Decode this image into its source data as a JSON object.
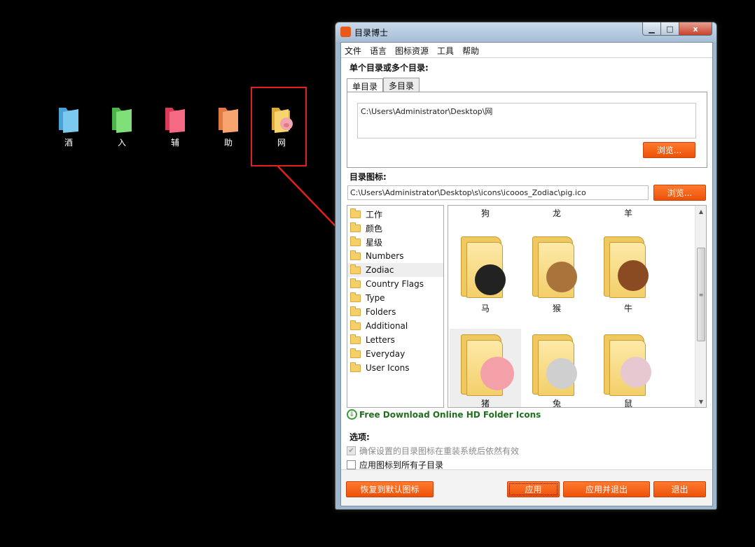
{
  "desktop": {
    "icons": [
      {
        "label": "酒",
        "color": "#5bb8e8"
      },
      {
        "label": "入",
        "color": "#6fd36a"
      },
      {
        "label": "辅",
        "color": "#f0506a"
      },
      {
        "label": "助",
        "color": "#f2955a"
      },
      {
        "label": "网",
        "color": "#f2c95a"
      }
    ]
  },
  "window": {
    "title": "目录博士",
    "controls": {
      "minimize": "▁",
      "maximize": "□",
      "close": "x"
    }
  },
  "menu": [
    "文件",
    "语言",
    "图标资源",
    "工具",
    "帮助"
  ],
  "directory_section": {
    "label": "单个目录或多个目录:",
    "tabs": [
      "单目录",
      "多目录"
    ],
    "active_tab": "单目录",
    "path": "C:\\Users\\Administrator\\Desktop\\网",
    "browse": "浏览..."
  },
  "icon_section": {
    "label": "目录图标:",
    "path": "C:\\Users\\Administrator\\Desktop\\s\\icons\\icooos_Zodiac\\pig.ico",
    "browse": "浏览..."
  },
  "categories": [
    "工作",
    "颜色",
    "星级",
    "Numbers",
    "Zodiac",
    "Country Flags",
    "Type",
    "Folders",
    "Additional",
    "Letters",
    "Everyday",
    "User Icons"
  ],
  "selected_category": "Zodiac",
  "icon_grid": {
    "top_row": [
      "狗",
      "龙",
      "羊"
    ],
    "rows": [
      [
        {
          "name": "马",
          "color": "#222222",
          "glyph": "马"
        },
        {
          "name": "猴",
          "color": "#a8743c",
          "glyph": "猴"
        },
        {
          "name": "牛",
          "color": "#8a4a22",
          "glyph": "牛"
        }
      ],
      [
        {
          "name": "猪",
          "color": "#f4a0a8",
          "glyph": "猪"
        },
        {
          "name": "兔",
          "color": "#cfcfcf",
          "glyph": "兔"
        },
        {
          "name": "鼠",
          "color": "#e8c8d0",
          "glyph": "鼠"
        }
      ]
    ],
    "selected": "猪"
  },
  "download_link": "Free Download Online HD Folder Icons",
  "options": {
    "label": "选项:",
    "items": [
      {
        "label": "确保设置的目录图标在重装系统后依然有效",
        "checked": true,
        "disabled": true
      },
      {
        "label": "应用图标到所有子目录",
        "checked": false,
        "disabled": false
      }
    ]
  },
  "buttons": {
    "restore": "恢复到默认图标",
    "apply": "应用",
    "apply_exit": "应用并退出",
    "exit": "退出"
  },
  "colors": {
    "accent": "#ec5108",
    "highlight": "#e0201c",
    "link": "#1f6f1f"
  }
}
